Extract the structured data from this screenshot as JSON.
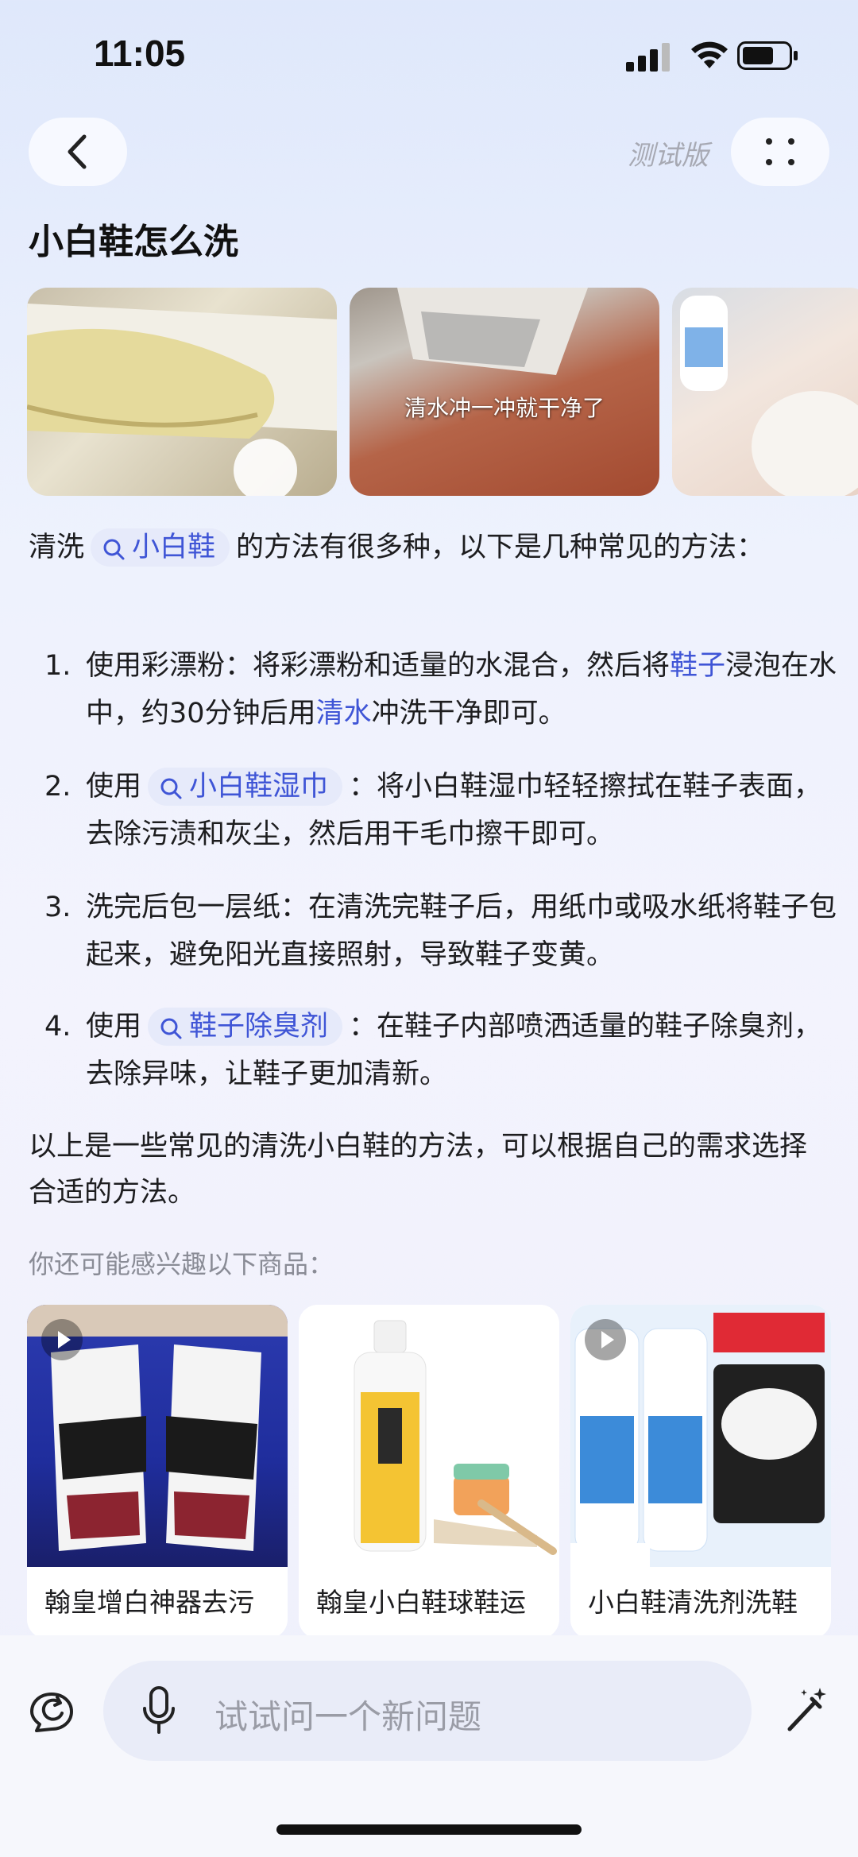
{
  "status_bar": {
    "time": "11:05"
  },
  "nav": {
    "beta_label": "测试版"
  },
  "page": {
    "title": "小白鞋怎么洗"
  },
  "images": [
    {
      "caption": ""
    },
    {
      "caption": "清水冲一冲就干净了"
    },
    {
      "caption": ""
    }
  ],
  "answer": {
    "intro_pre": "清洗",
    "intro_chip": "小白鞋",
    "intro_post": "的方法有很多种，以下是几种常见的方法：",
    "items": [
      {
        "num": "1.",
        "pre": "使用彩漂粉：将彩漂粉和适量的水混合，然后将",
        "link1": "鞋子",
        "mid": "浸泡在水中，约30分钟后用",
        "link2": "清水",
        "post": "冲洗干净即可。"
      },
      {
        "num": "2.",
        "pre": "使用",
        "chip": "小白鞋湿巾",
        "post": "：将小白鞋湿巾轻轻擦拭在鞋子表面，去除污渍和灰尘，然后用干毛巾擦干即可。"
      },
      {
        "num": "3.",
        "text": "洗完后包一层纸：在清洗完鞋子后，用纸巾或吸水纸将鞋子包起来，避免阳光直接照射，导致鞋子变黄。"
      },
      {
        "num": "4.",
        "pre": "使用",
        "chip": "鞋子除臭剂",
        "post": "：在鞋子内部喷洒适量的鞋子除臭剂，去除异味，让鞋子更加清新。"
      }
    ],
    "summary": "以上是一些常见的清洗小白鞋的方法，可以根据自己的需求选择合适的方法。"
  },
  "recommend": {
    "heading": "你还可能感兴趣以下商品：",
    "products": [
      {
        "title": "翰皇增白神器去污"
      },
      {
        "title": "翰皇小白鞋球鞋运"
      },
      {
        "title": "小白鞋清洗剂洗鞋"
      }
    ]
  },
  "input": {
    "placeholder": "试试问一个新问题"
  }
}
